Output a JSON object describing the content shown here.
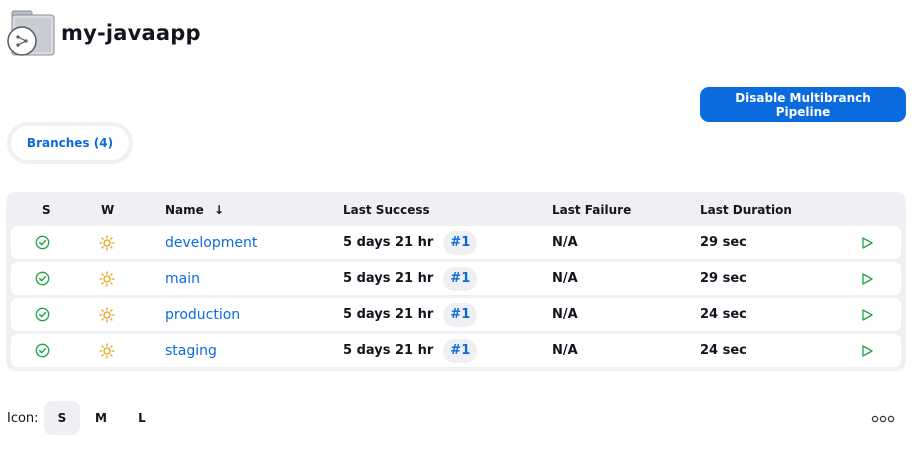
{
  "page": {
    "title": "my-javaapp"
  },
  "actions": {
    "disable_label": "Disable Multibranch Pipeline"
  },
  "tabs": [
    {
      "label": "Branches (4)"
    }
  ],
  "table": {
    "headers": {
      "s": "S",
      "w": "W",
      "name": "Name",
      "name_sort": "↓",
      "last_success": "Last Success",
      "last_failure": "Last Failure",
      "last_duration": "Last Duration"
    },
    "rows": [
      {
        "status_icon": "success-check-icon",
        "weather_icon": "sunny-icon",
        "name": "development",
        "last_success": "5 days 21 hr",
        "build": "#1",
        "last_failure": "N/A",
        "last_duration": "29 sec",
        "action_icon": "play-icon"
      },
      {
        "status_icon": "success-check-icon",
        "weather_icon": "sunny-icon",
        "name": "main",
        "last_success": "5 days 21 hr",
        "build": "#1",
        "last_failure": "N/A",
        "last_duration": "29 sec",
        "action_icon": "play-icon"
      },
      {
        "status_icon": "success-check-icon",
        "weather_icon": "sunny-icon",
        "name": "production",
        "last_success": "5 days 21 hr",
        "build": "#1",
        "last_failure": "N/A",
        "last_duration": "24 sec",
        "action_icon": "play-icon"
      },
      {
        "status_icon": "success-check-icon",
        "weather_icon": "sunny-icon",
        "name": "staging",
        "last_success": "5 days 21 hr",
        "build": "#1",
        "last_failure": "N/A",
        "last_duration": "24 sec",
        "action_icon": "play-icon"
      }
    ]
  },
  "footer": {
    "icon_label": "Icon:",
    "sizes": [
      "S",
      "M",
      "L"
    ],
    "selected_size": "S"
  },
  "colors": {
    "accent": "#0b6bde",
    "success": "#1ea446",
    "weather": "#e6a117",
    "panel": "#eef0f4"
  }
}
